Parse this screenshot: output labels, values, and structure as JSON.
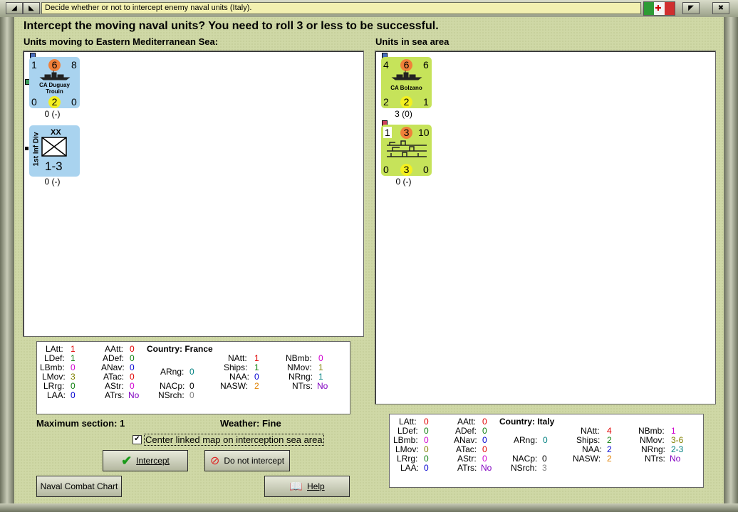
{
  "window": {
    "title": "Decide whether or not to intercept enemy naval units (Italy)."
  },
  "heading": "Intercept the moving naval units?  You need to roll 3 or less to be successful.",
  "left_label": "Units moving to Eastern Mediterranean Sea:",
  "right_label": "Units in sea area",
  "left_units": [
    {
      "tl": "1",
      "tc": "6",
      "tr": "8",
      "name1": "CA Duguay",
      "name2": "Trouin",
      "bl": "0",
      "bc": "2",
      "br": "0",
      "status": "0 (-)"
    },
    {
      "xx": "XX",
      "side_name": "1st Inf Div",
      "strength": "1-3",
      "status": "0 (-)"
    }
  ],
  "right_units": [
    {
      "tl": "4",
      "tc": "6",
      "tr": "6",
      "name1": "CA Bolzano",
      "bl": "2",
      "bc": "2",
      "br": "1",
      "status": "3 (0)"
    },
    {
      "tl": "1",
      "tc": "3",
      "tr": "10",
      "bl": "0",
      "bc": "3",
      "br": "0",
      "status": "0 (-)"
    }
  ],
  "france_stats": {
    "country": "Country: France",
    "LAtt": {
      "k": "LAtt:",
      "v": "1"
    },
    "LDef": {
      "k": "LDef:",
      "v": "1"
    },
    "LBmb": {
      "k": "LBmb:",
      "v": "0"
    },
    "LMov": {
      "k": "LMov:",
      "v": "3"
    },
    "LRrg": {
      "k": "LRrg:",
      "v": "0"
    },
    "LAA": {
      "k": "LAA:",
      "v": "0"
    },
    "AAtt": {
      "k": "AAtt:",
      "v": "0"
    },
    "ADef": {
      "k": "ADef:",
      "v": "0"
    },
    "ANav": {
      "k": "ANav:",
      "v": "0"
    },
    "ATac": {
      "k": "ATac:",
      "v": "0"
    },
    "AStr": {
      "k": "AStr:",
      "v": "0"
    },
    "ATrs": {
      "k": "ATrs:",
      "v": "No"
    },
    "ARng": {
      "k": "ARng:",
      "v": "0"
    },
    "NACp": {
      "k": "NACp:",
      "v": "0"
    },
    "NSrch": {
      "k": "NSrch:",
      "v": "0"
    },
    "NAtt": {
      "k": "NAtt:",
      "v": "1"
    },
    "Ships": {
      "k": "Ships:",
      "v": "1"
    },
    "NAA": {
      "k": "NAA:",
      "v": "0"
    },
    "NASW": {
      "k": "NASW:",
      "v": "2"
    },
    "NBmb": {
      "k": "NBmb:",
      "v": "0"
    },
    "NMov": {
      "k": "NMov:",
      "v": "1"
    },
    "NRng": {
      "k": "NRng:",
      "v": "1"
    },
    "NTrs": {
      "k": "NTrs:",
      "v": "No"
    }
  },
  "italy_stats": {
    "country": "Country: Italy",
    "LAtt": {
      "k": "LAtt:",
      "v": "0"
    },
    "LDef": {
      "k": "LDef:",
      "v": "0"
    },
    "LBmb": {
      "k": "LBmb:",
      "v": "0"
    },
    "LMov": {
      "k": "LMov:",
      "v": "0"
    },
    "LRrg": {
      "k": "LRrg:",
      "v": "0"
    },
    "LAA": {
      "k": "LAA:",
      "v": "0"
    },
    "AAtt": {
      "k": "AAtt:",
      "v": "0"
    },
    "ADef": {
      "k": "ADef:",
      "v": "0"
    },
    "ANav": {
      "k": "ANav:",
      "v": "0"
    },
    "ATac": {
      "k": "ATac:",
      "v": "0"
    },
    "AStr": {
      "k": "AStr:",
      "v": "0"
    },
    "ATrs": {
      "k": "ATrs:",
      "v": "No"
    },
    "ARng": {
      "k": "ARng:",
      "v": "0"
    },
    "NACp": {
      "k": "NACp:",
      "v": "0"
    },
    "NSrch": {
      "k": "NSrch:",
      "v": "3"
    },
    "NAtt": {
      "k": "NAtt:",
      "v": "4"
    },
    "Ships": {
      "k": "Ships:",
      "v": "2"
    },
    "NAA": {
      "k": "NAA:",
      "v": "2"
    },
    "NASW": {
      "k": "NASW:",
      "v": "2"
    },
    "NBmb": {
      "k": "NBmb:",
      "v": "1"
    },
    "NMov": {
      "k": "NMov:",
      "v": "3-6"
    },
    "NRng": {
      "k": "NRng:",
      "v": "2-3"
    },
    "NTrs": {
      "k": "NTrs:",
      "v": "No"
    }
  },
  "max_section": "Maximum section: 1",
  "weather": "Weather:  Fine",
  "center_checkbox": {
    "label": "Center linked map on interception sea area",
    "checked": true,
    "mark": "✔"
  },
  "buttons": {
    "intercept": "Intercept",
    "no_intercept": "Do not intercept",
    "naval_chart": "Naval Combat Chart",
    "help": "Help"
  },
  "colors": {
    "blue_counter": "#a9d3ef",
    "green_counter": "#c6e35a",
    "orange_circle": "#f0803a",
    "yellow_circle": "#f4f020"
  }
}
